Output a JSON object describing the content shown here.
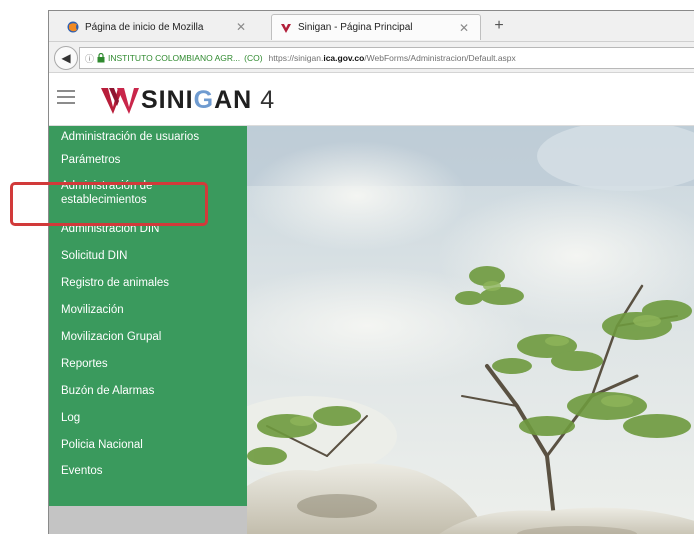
{
  "browser": {
    "tabs": [
      {
        "title": "Página de inicio de Mozilla",
        "active": false,
        "favicon": "firefox-icon"
      },
      {
        "title": "Sinigan - Página Principal",
        "active": true,
        "favicon": "sinigan-icon"
      }
    ],
    "new_tab_label": "+",
    "close_label": "✕",
    "back_label": "◀",
    "url": {
      "org": "INSTITUTO COLOMBIANO AGR...",
      "country": "(CO)",
      "prefix": "https://sinigan.",
      "domain": "ica.gov.co",
      "path": "/WebForms/Administracion/Default.aspx"
    }
  },
  "header": {
    "brand_a": "SINI",
    "brand_b": "G",
    "brand_c": "AN",
    "version": "4"
  },
  "sidebar": {
    "items": [
      {
        "label": "Administración de usuarios"
      },
      {
        "label": "Parámetros"
      },
      {
        "label": "Administración de\nestablecimientos",
        "highlighted": true
      },
      {
        "label": "Administración DIN"
      },
      {
        "label": "Solicitud DIN"
      },
      {
        "label": "Registro de animales"
      },
      {
        "label": "Movilización"
      },
      {
        "label": "Movilizacion Grupal"
      },
      {
        "label": "Reportes"
      },
      {
        "label": "Buzón de Alarmas"
      },
      {
        "label": "Log"
      },
      {
        "label": "Policia Nacional"
      },
      {
        "label": "Eventos"
      }
    ]
  },
  "colors": {
    "sidebar_bg": "#3a9a5d",
    "highlight": "#d13a3a",
    "brand_accent": "#6f9bd0"
  }
}
